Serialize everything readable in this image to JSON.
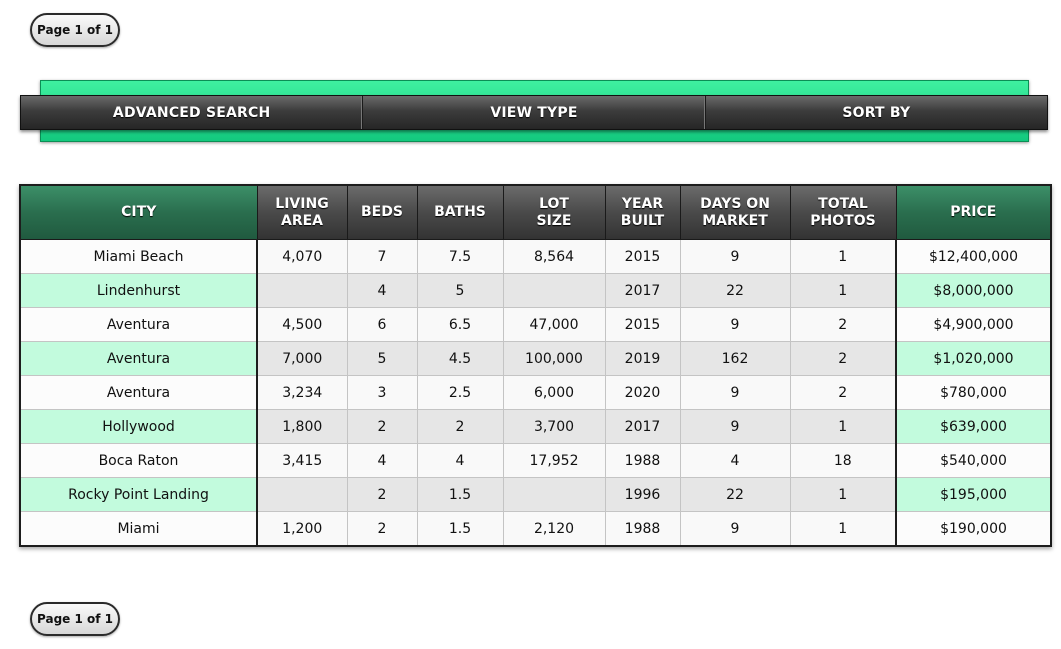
{
  "pager": {
    "label": "Page 1 of 1"
  },
  "nav": {
    "items": [
      {
        "label": "ADVANCED SEARCH"
      },
      {
        "label": "VIEW TYPE"
      },
      {
        "label": "SORT BY"
      }
    ]
  },
  "table": {
    "headers": [
      "CITY",
      "LIVING\nAREA",
      "BEDS",
      "BATHS",
      "LOT\nSIZE",
      "YEAR\nBUILT",
      "DAYS ON\nMARKET",
      "TOTAL\nPHOTOS",
      "PRICE"
    ],
    "rows": [
      [
        "Miami Beach",
        "4,070",
        "7",
        "7.5",
        "8,564",
        "2015",
        "9",
        "1",
        "$12,400,000"
      ],
      [
        "Lindenhurst",
        "",
        "4",
        "5",
        "",
        "2017",
        "22",
        "1",
        "$8,000,000"
      ],
      [
        "Aventura",
        "4,500",
        "6",
        "6.5",
        "47,000",
        "2015",
        "9",
        "2",
        "$4,900,000"
      ],
      [
        "Aventura",
        "7,000",
        "5",
        "4.5",
        "100,000",
        "2019",
        "162",
        "2",
        "$1,020,000"
      ],
      [
        "Aventura",
        "3,234",
        "3",
        "2.5",
        "6,000",
        "2020",
        "9",
        "2",
        "$780,000"
      ],
      [
        "Hollywood",
        "1,800",
        "2",
        "2",
        "3,700",
        "2017",
        "9",
        "1",
        "$639,000"
      ],
      [
        "Boca Raton",
        "3,415",
        "4",
        "4",
        "17,952",
        "1988",
        "4",
        "18",
        "$540,000"
      ],
      [
        "Rocky Point Landing",
        "",
        "2",
        "1.5",
        "",
        "1996",
        "22",
        "1",
        "$195,000"
      ],
      [
        "Miami",
        "1,200",
        "2",
        "1.5",
        "2,120",
        "1988",
        "9",
        "1",
        "$190,000"
      ]
    ]
  },
  "colors": {
    "accent_green": "#2a6e4e",
    "highlight_row": "#c2fbdd",
    "nav_green": "#1fd68a"
  }
}
